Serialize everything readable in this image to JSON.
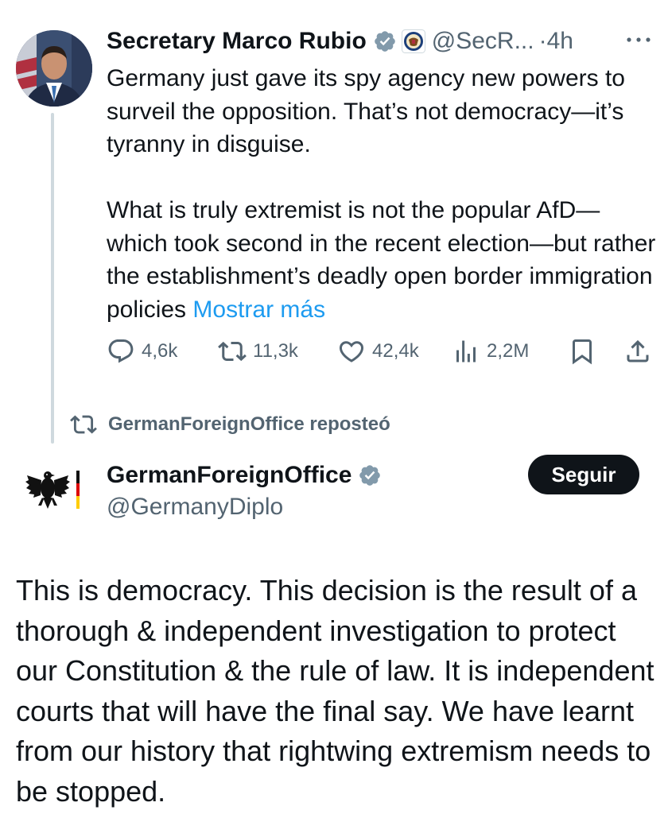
{
  "tweet": {
    "author_name": "Secretary Marco Rubio",
    "handle": "@SecR...",
    "separator": "·",
    "time": "4h",
    "paragraph1": "Germany just gave its spy agency new powers to surveil the opposition.  That’s not democracy—it’s tyranny in disguise.",
    "paragraph2": "What is truly extremist is not the popular AfD—which took second in the recent election—but rather the establishment’s deadly open border immigration policies ",
    "show_more": "Mostrar más",
    "replies": "4,6k",
    "reposts": "11,3k",
    "likes": "42,4k",
    "views": "2,2M"
  },
  "repost_banner": {
    "text": "GermanForeignOffice reposteó"
  },
  "reply": {
    "author_name": "GermanForeignOffice",
    "handle": "@GermanyDiplo",
    "follow_label": "Seguir",
    "body": "This is democracy. This decision is the result of a thorough & independent investigation to protect our Constitution & the rule of law. It is independent courts that will have the final say. We have learnt from our history that rightwing extremism needs to be stopped."
  },
  "colors": {
    "text": "#0f1419",
    "secondary": "#536471",
    "link": "#1d9bf0",
    "verified_badge": "#829aab",
    "thread_line": "#cfd9de",
    "button_bg": "#0f1419"
  },
  "icons": {
    "more": "more-horizontal-icon",
    "reply": "reply-icon",
    "repost": "repost-icon",
    "like": "heart-icon",
    "views": "views-icon",
    "bookmark": "bookmark-icon",
    "share": "share-icon",
    "verified": "verified-badge-icon",
    "seal": "state-department-seal-icon",
    "eagle": "federal-eagle-logo-icon"
  }
}
